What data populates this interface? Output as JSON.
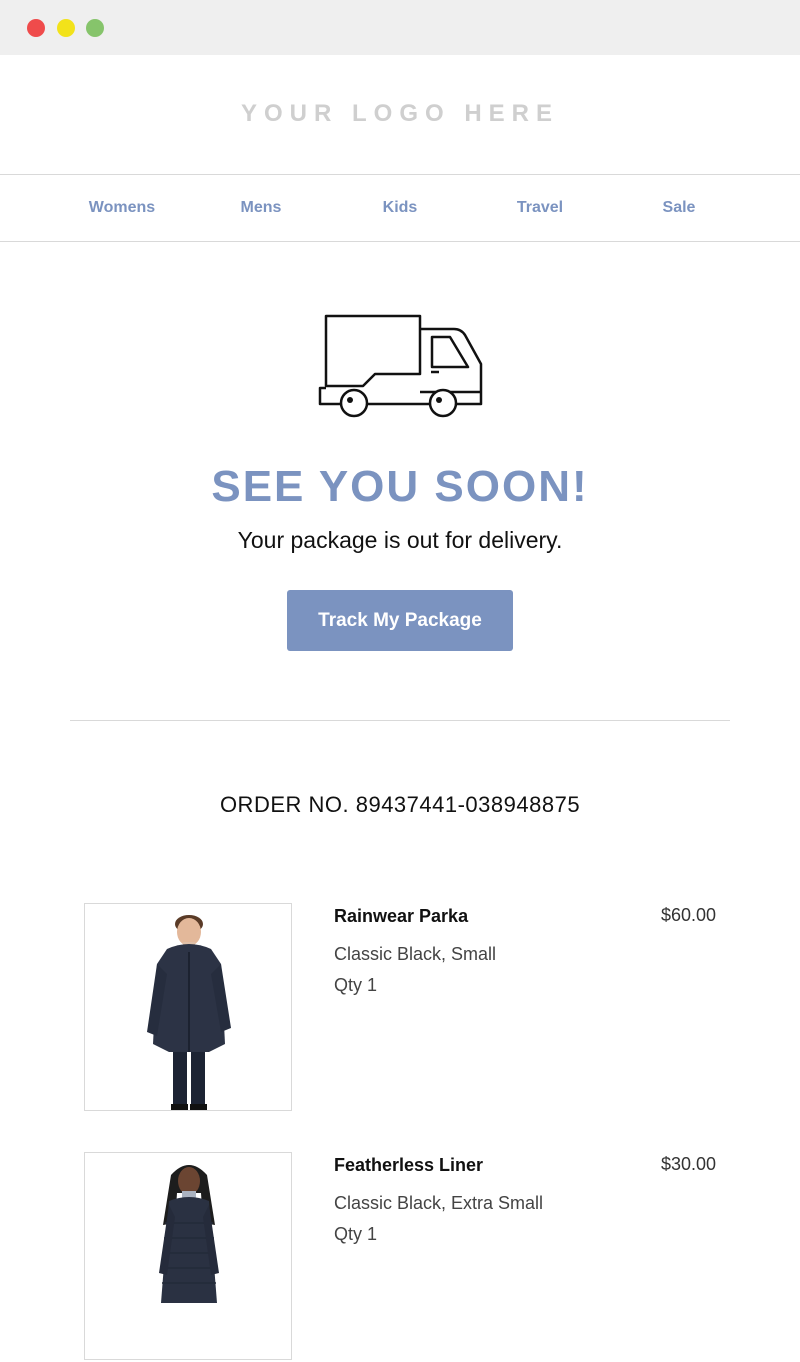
{
  "header": {
    "logo_text": "YOUR LOGO HERE"
  },
  "nav": {
    "items": [
      "Womens",
      "Mens",
      "Kids",
      "Travel",
      "Sale"
    ]
  },
  "hero": {
    "icon": "delivery-truck-icon",
    "headline": "SEE YOU SOON!",
    "subtitle": "Your package is out for delivery.",
    "cta_label": "Track My Package"
  },
  "order": {
    "number_text": "ORDER NO. 89437441-038948875",
    "items": [
      {
        "name": "Rainwear Parka",
        "variant": "Classic Black, Small",
        "qty": "Qty 1",
        "price": "$60.00"
      },
      {
        "name": "Featherless Liner",
        "variant": "Classic Black, Extra Small",
        "qty": "Qty 1",
        "price": "$30.00"
      }
    ]
  },
  "colors": {
    "accent": "#7b93c0",
    "titlebar": "#efefef",
    "divider": "#d9d9d9"
  }
}
